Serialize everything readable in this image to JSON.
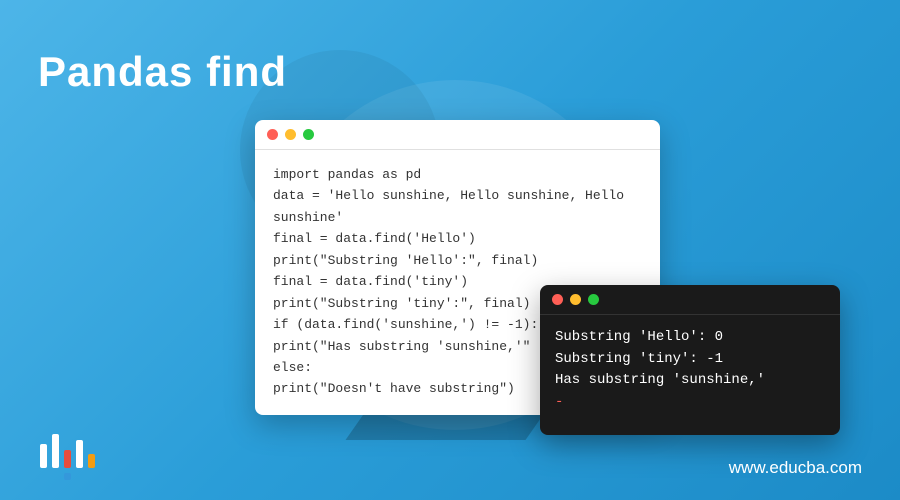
{
  "title": "Pandas find",
  "code": {
    "line1": "import pandas as pd",
    "line2": "data = 'Hello sunshine, Hello sunshine, Hello sunshine'",
    "line3": "final = data.find('Hello')",
    "line4": "print(\"Substring 'Hello':\", final)",
    "line5": "final = data.find('tiny')",
    "line6": "print(\"Substring 'tiny':\", final)",
    "line7": "if (data.find('sunshine,') != -1):",
    "line8": "print(\"Has substring 'sunshine,'\"",
    "line9": "else:",
    "line10": "print(\"Doesn't have substring\")"
  },
  "terminal": {
    "line1": "Substring 'Hello': 0",
    "line2": "Substring 'tiny': -1",
    "line3": "Has substring 'sunshine,'",
    "cursor": "-"
  },
  "website": "www.educba.com"
}
